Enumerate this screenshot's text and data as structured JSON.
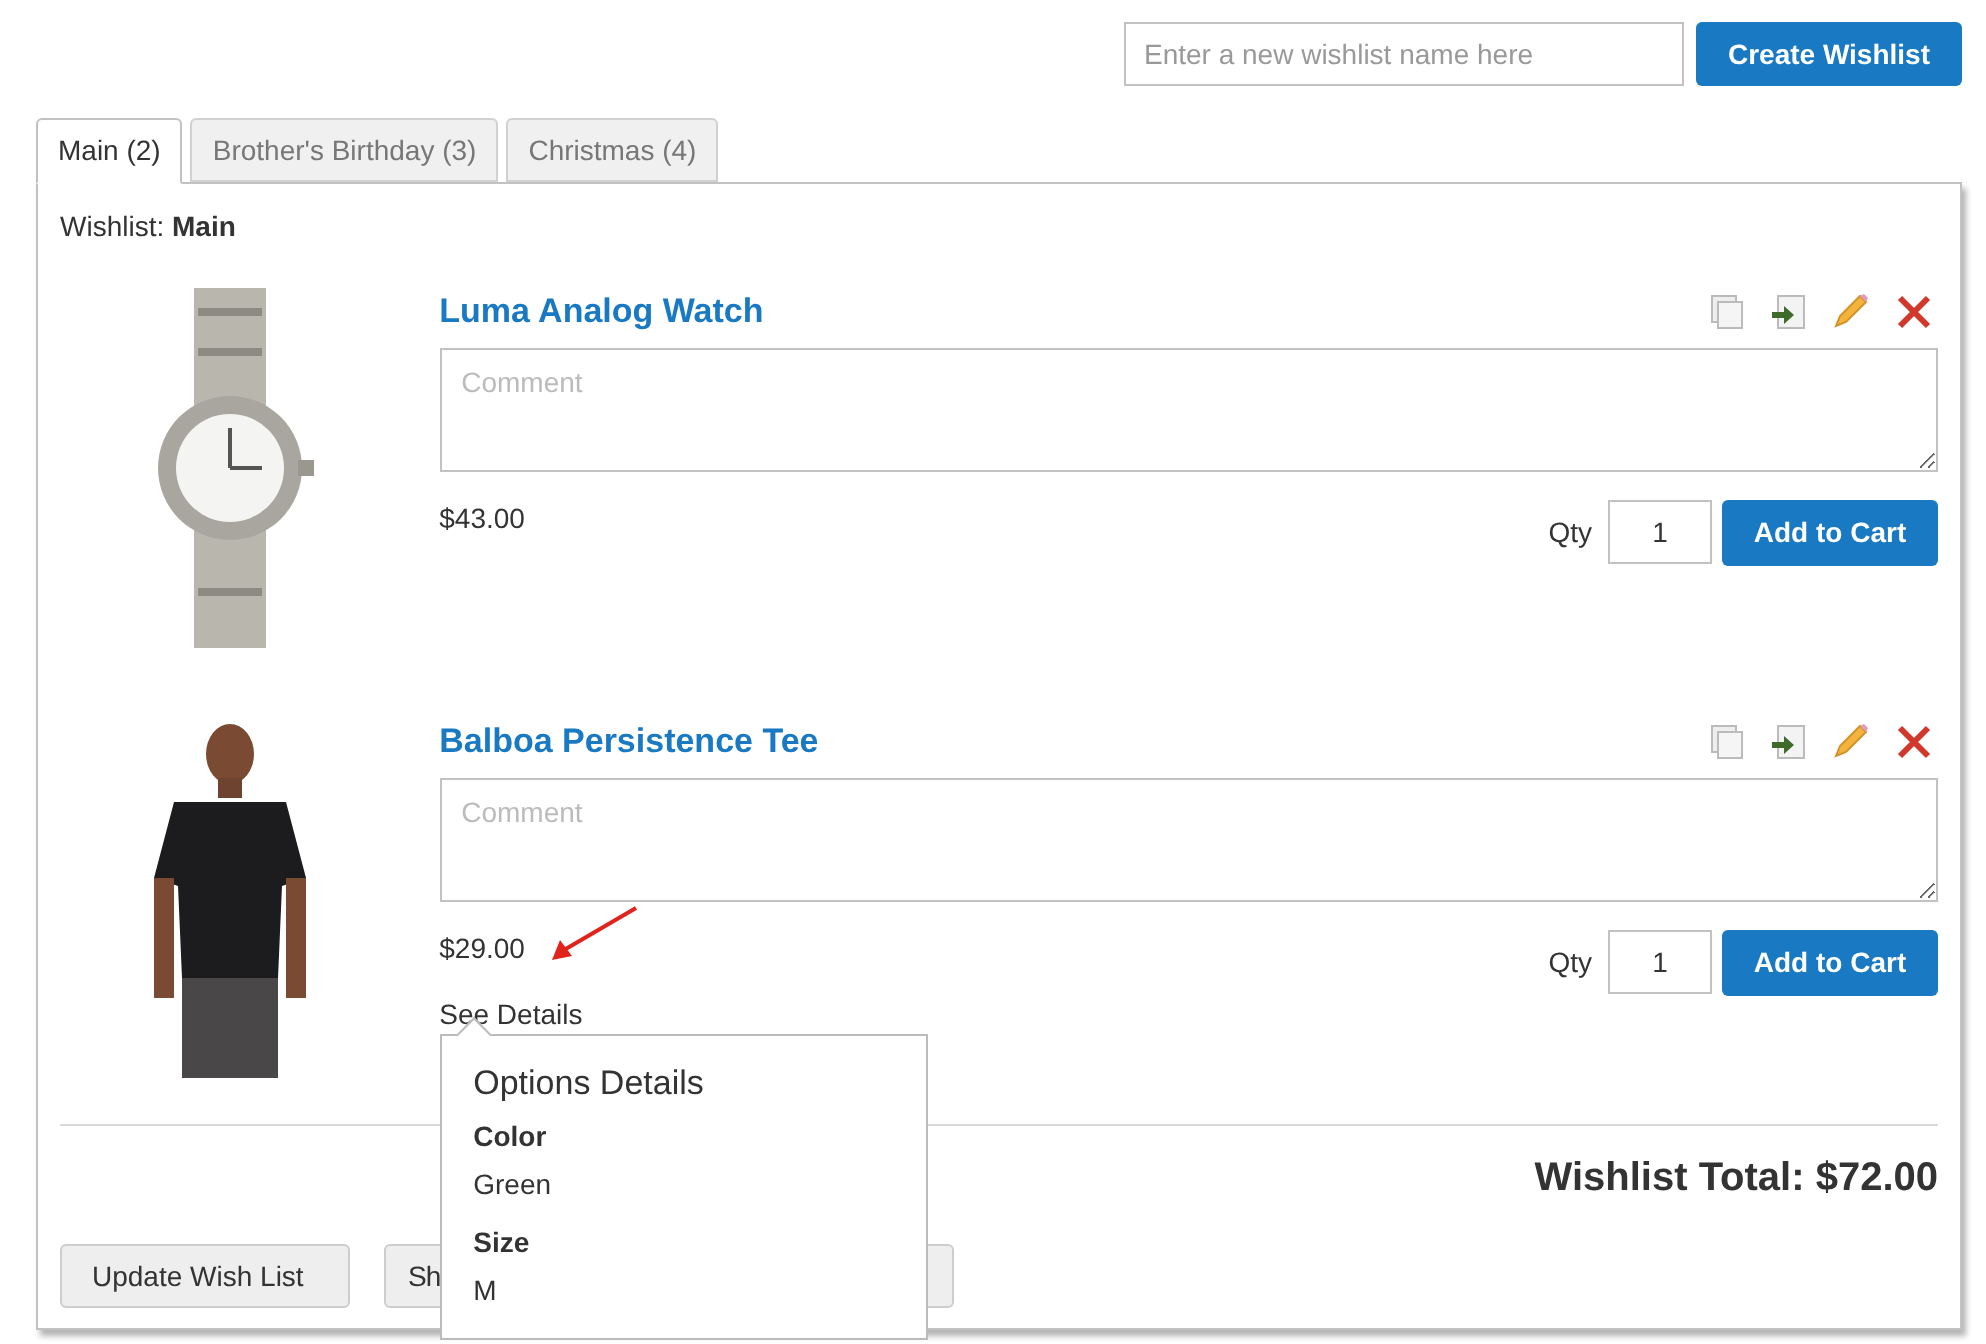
{
  "new_wishlist": {
    "placeholder": "Enter a new wishlist name here",
    "button": "Create Wishlist"
  },
  "tabs": [
    {
      "label": "Main (2)",
      "selected": true
    },
    {
      "label": "Brother's Birthday (3)",
      "selected": false
    },
    {
      "label": "Christmas (4)",
      "selected": false
    }
  ],
  "wishlist_label": "Wishlist: **Main**",
  "items": [
    {
      "kind": "watch",
      "name": "Luma Analog Watch",
      "comment_placeholder": "Comment",
      "price": "$43.00",
      "qty_label": "Qty",
      "qty": "1",
      "button": "Add to Cart"
    },
    {
      "kind": "tee",
      "name": "Balboa Persistence Tee",
      "comment_placeholder": "Comment",
      "price": "$29.00",
      "details_link": "See Details",
      "qty_label": "Qty",
      "qty": "1",
      "button": "Add to Cart",
      "options_popup": {
        "title": "Options Details",
        "options": [
          {
            "label": "Color",
            "value": "Green"
          },
          {
            "label": "Size",
            "value": "M"
          }
        ]
      }
    }
  ],
  "total": "Wishlist Total: $72.00",
  "buttons": [
    "Update Wish List",
    "Sh"
  ]
}
